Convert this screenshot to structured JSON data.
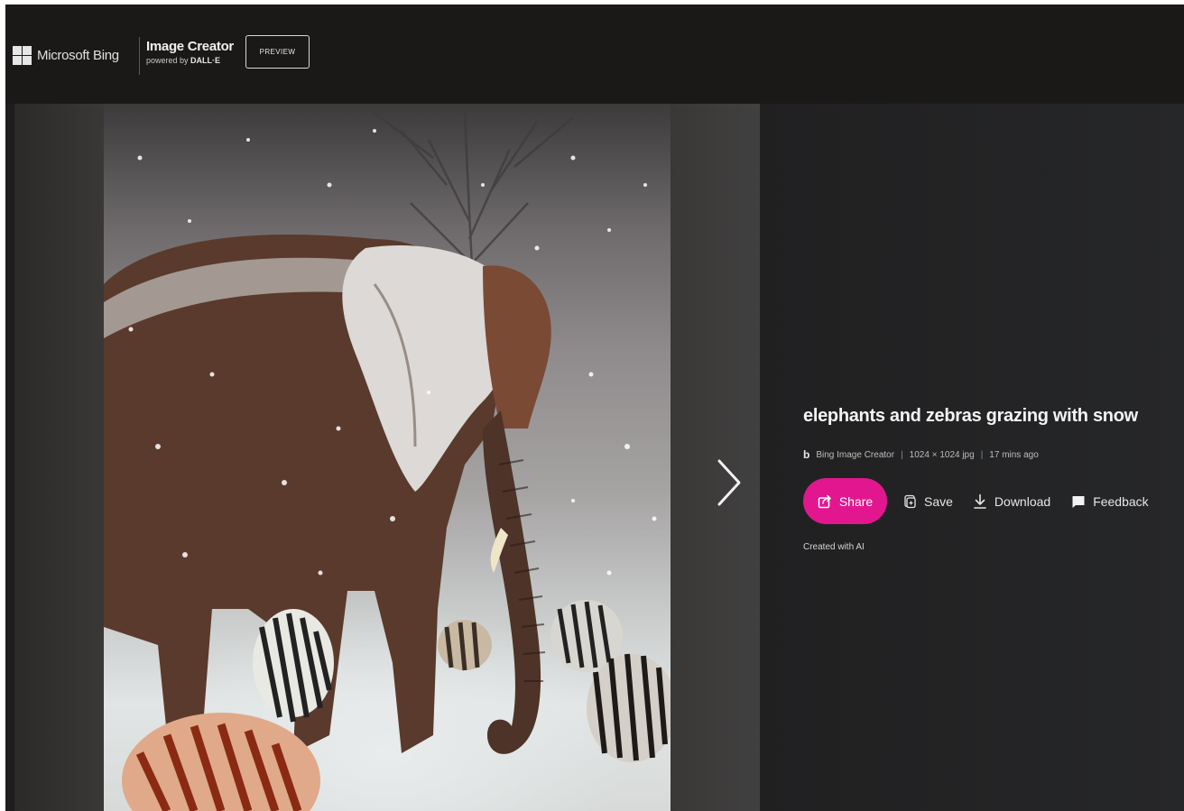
{
  "header": {
    "brand": "Microsoft Bing",
    "product_title": "Image Creator",
    "product_sub_prefix": "powered by",
    "product_sub_strong": "DALL·E",
    "preview_badge": "PREVIEW"
  },
  "image": {
    "description_alt": "elephants and zebras grazing with snow"
  },
  "info": {
    "title": "elephants and zebras grazing with snow",
    "meta_source": "Bing Image Creator",
    "meta_size": "1024 × 1024 jpg",
    "meta_time": "17 mins ago",
    "meta_separator": "|",
    "created_note": "Created with AI"
  },
  "actions": {
    "share_label": "Share",
    "save_label": "Save",
    "download_label": "Download",
    "feedback_label": "Feedback"
  },
  "colors": {
    "share_accent": "#e2178f",
    "background": "#1e1c1c"
  },
  "icons": {
    "share": "share-icon",
    "save": "save-icon",
    "download": "download-icon",
    "feedback": "feedback-icon",
    "next": "chevron-right-icon",
    "logo": "microsoft-logo-icon"
  }
}
